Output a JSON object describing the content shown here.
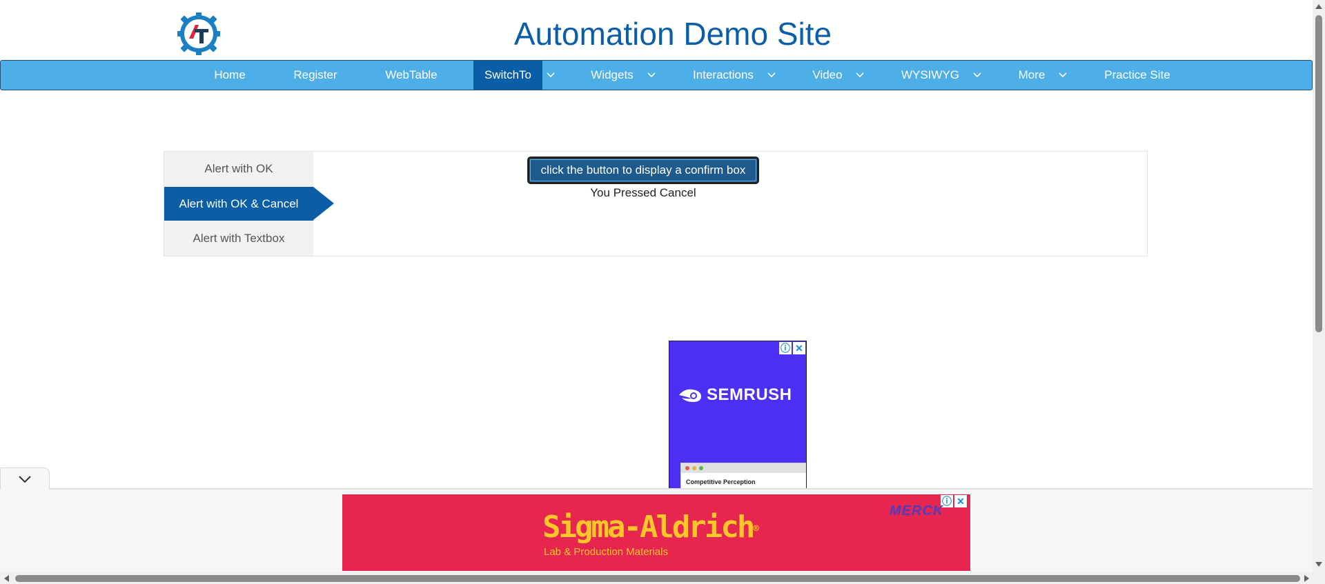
{
  "header": {
    "site_title": "Automation Demo Site",
    "logo_text": "AT"
  },
  "nav": {
    "items": [
      {
        "label": "Home",
        "has_dropdown": false
      },
      {
        "label": "Register",
        "has_dropdown": false
      },
      {
        "label": "WebTable",
        "has_dropdown": false
      },
      {
        "label": "SwitchTo",
        "has_dropdown": true,
        "active": true
      },
      {
        "label": "Widgets",
        "has_dropdown": true
      },
      {
        "label": "Interactions",
        "has_dropdown": true
      },
      {
        "label": "Video",
        "has_dropdown": true
      },
      {
        "label": "WYSIWYG",
        "has_dropdown": true
      },
      {
        "label": "More",
        "has_dropdown": true
      },
      {
        "label": "Practice Site",
        "has_dropdown": false
      }
    ]
  },
  "tabs": {
    "items": [
      {
        "label": "Alert with OK"
      },
      {
        "label": "Alert with OK & Cancel",
        "active": true
      },
      {
        "label": "Alert with Textbox"
      }
    ]
  },
  "content": {
    "button_label": "click the button to display a confirm box",
    "result_text": "You Pressed Cancel"
  },
  "ads": {
    "square": {
      "brand": "SEMRUSH",
      "window_text": "Competitive Perception"
    },
    "banner": {
      "title": "Sigma-Aldrich",
      "registered": "®",
      "subtitle": "Lab & Production Materials",
      "sponsor": "MERCK"
    },
    "info_icon": "ⓘ",
    "close_icon": "✕"
  },
  "colors": {
    "nav_bg": "#4eaee8",
    "active_bg": "#0a5ea8",
    "title_color": "#0a5ea8",
    "ad_square_bg": "#4b2ff2",
    "ad_banner_bg": "#e7264f",
    "ad_banner_text": "#ffc629"
  }
}
